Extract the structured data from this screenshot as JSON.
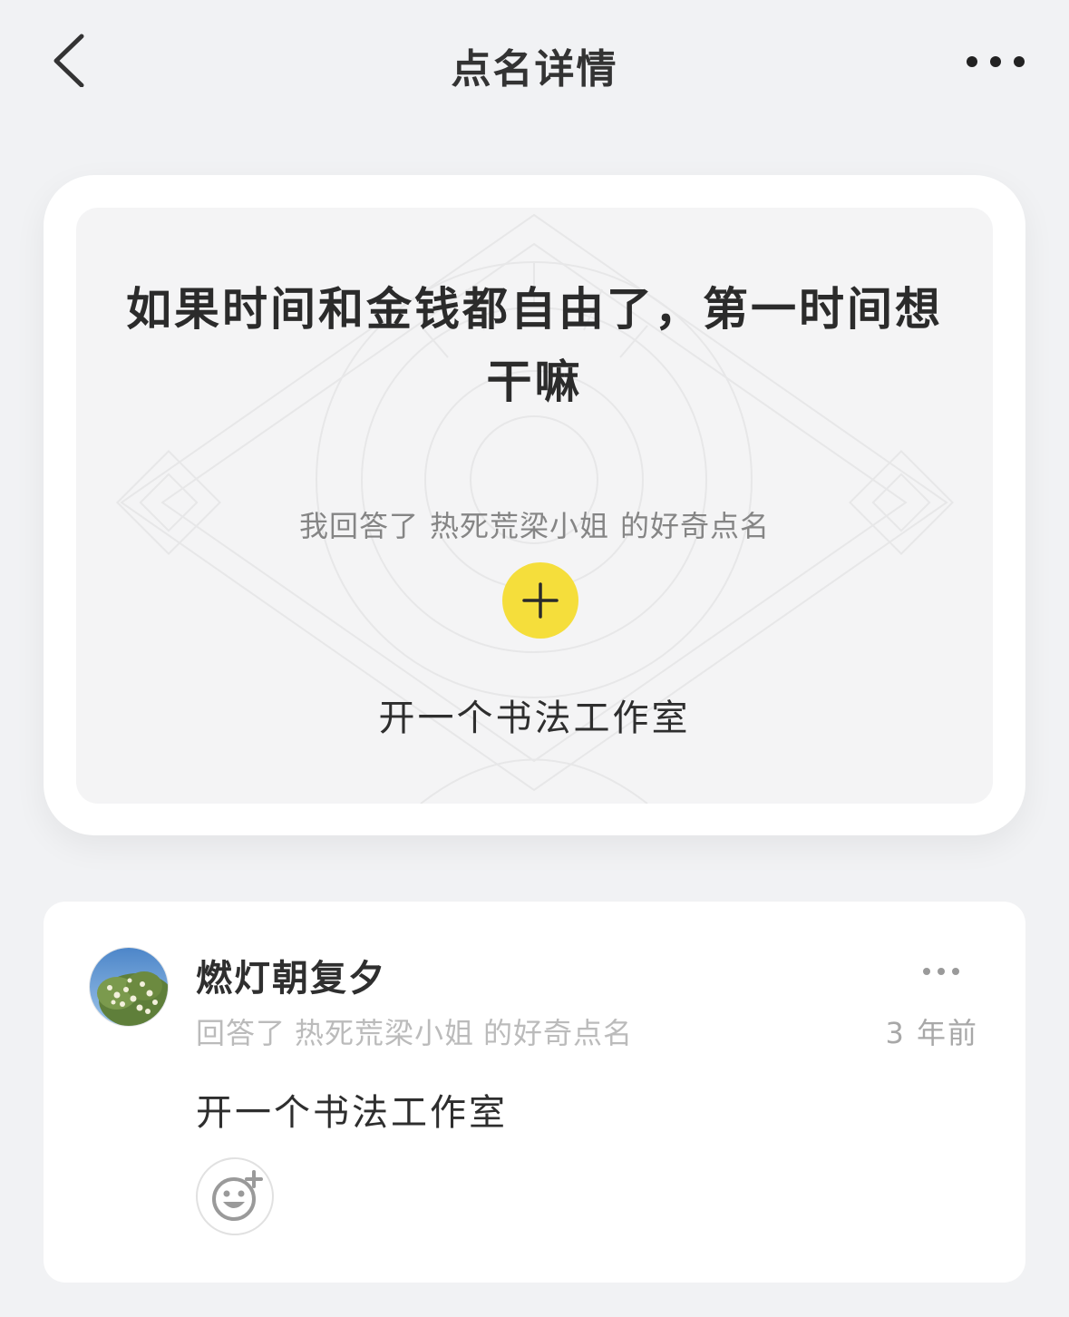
{
  "nav": {
    "title": "点名详情",
    "back_icon": "chevron-left-icon",
    "more_icon": "more-horizontal-icon"
  },
  "prompt_card": {
    "question": "如果时间和金钱都自由了，第一时间想干嘛",
    "answered_prefix": "我回答了",
    "asker": "热死荒梁小姐",
    "answered_suffix": "的好奇点名",
    "plus_icon": "plus-icon",
    "answer": "开一个书法工作室",
    "accent_color": "#f5de3b"
  },
  "post": {
    "username": "燃灯朝复夕",
    "avatar_icon": "flower-tree-avatar",
    "sub_prefix": "回答了",
    "asker": "热死荒梁小姐",
    "sub_suffix": "的好奇点名",
    "timestamp": "3 年前",
    "text": "开一个书法工作室",
    "more_icon": "more-horizontal-icon",
    "reaction_icon": "add-emoji-icon"
  }
}
